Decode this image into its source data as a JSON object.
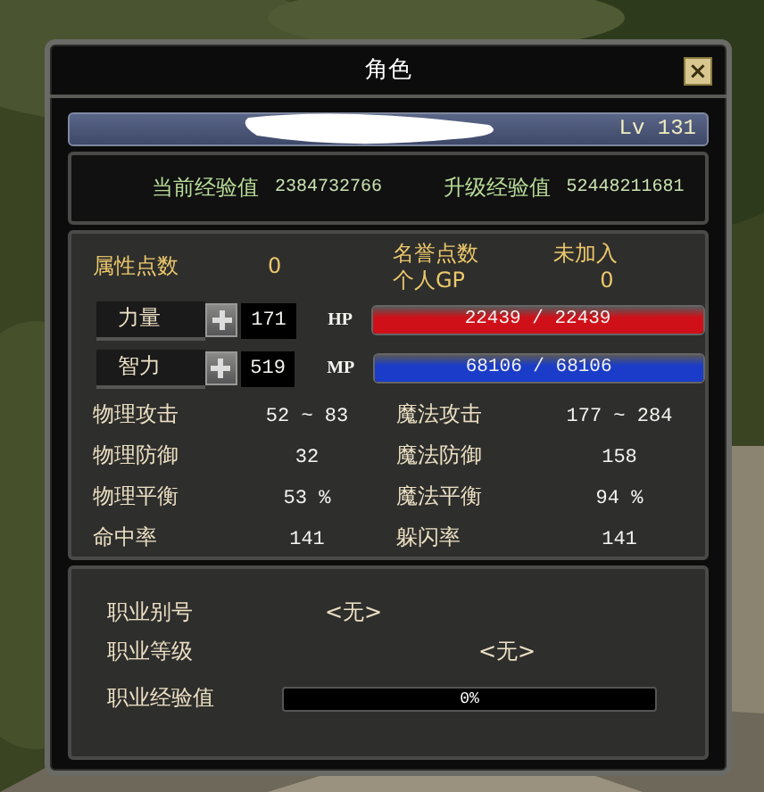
{
  "window": {
    "title": "角色",
    "close": "×"
  },
  "name_bar": {
    "level": "Lv 131"
  },
  "experience": [
    {
      "label": "当前经验值",
      "value": "2384732766"
    },
    {
      "label": "升级经验值",
      "value": "52448211681"
    }
  ],
  "points": {
    "attribute_label": "属性点数",
    "attribute_value": "0",
    "honor_label": "名誉点数",
    "honor_value": "未加入",
    "gp_label": "个人GP",
    "gp_value": "0"
  },
  "attributes": [
    {
      "label": "力量",
      "value": "171",
      "bar_label": "HP",
      "reading": "22439 / 22439",
      "level": 1,
      "color": "#d01018"
    },
    {
      "label": "智力",
      "value": "519",
      "bar_label": "MP",
      "reading": "68106 / 68106",
      "level": 1,
      "color": "#1a3cc8"
    }
  ],
  "stats": [
    {
      "label": "物理攻击",
      "value": "52 ~ 83"
    },
    {
      "label": "魔法攻击",
      "value": "177 ~ 284"
    },
    {
      "label": "物理防御",
      "value": "32"
    },
    {
      "label": "魔法防御",
      "value": "158"
    },
    {
      "label": "物理平衡",
      "value": "53 %"
    },
    {
      "label": "魔法平衡",
      "value": "94 %"
    },
    {
      "label": "命中率",
      "value": "141"
    },
    {
      "label": "躲闪率",
      "value": "141"
    }
  ],
  "job": {
    "alias_label": "职业别号",
    "alias_value": "<无>",
    "grade_label": "职业等级",
    "grade_value": "<无>",
    "exp_label": "职业经验值",
    "exp_reading": "0%",
    "level": 0
  }
}
